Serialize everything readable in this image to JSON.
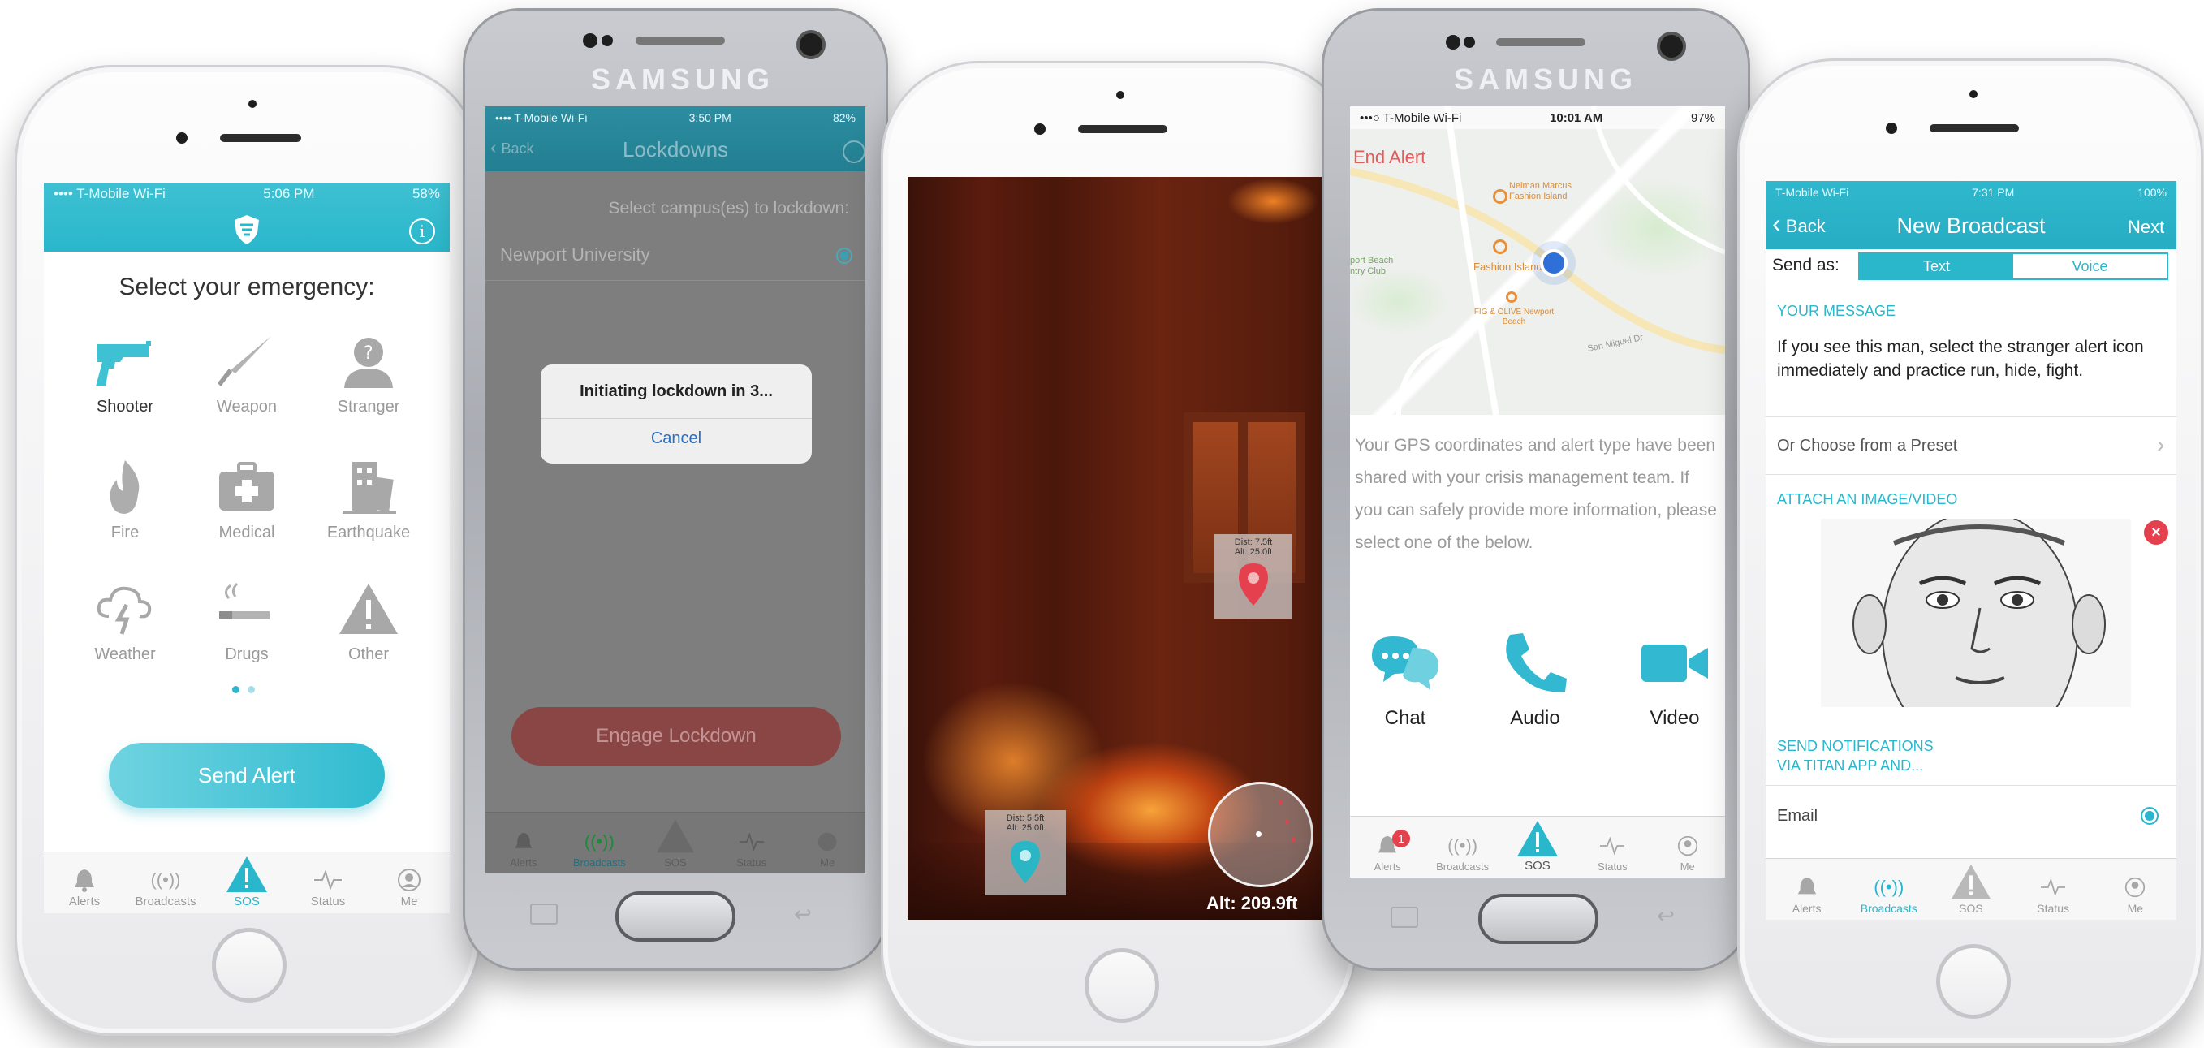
{
  "phone1": {
    "status": {
      "carrier": "•••• T-Mobile Wi-Fi",
      "time": "5:06 PM",
      "battery": "58%"
    },
    "heading": "Select your emergency:",
    "emergencies": [
      {
        "label": "Shooter",
        "icon": "gun-icon"
      },
      {
        "label": "Weapon",
        "icon": "knife-icon"
      },
      {
        "label": "Stranger",
        "icon": "stranger-icon"
      },
      {
        "label": "Fire",
        "icon": "fire-icon"
      },
      {
        "label": "Medical",
        "icon": "medical-kit-icon"
      },
      {
        "label": "Earthquake",
        "icon": "earthquake-icon"
      },
      {
        "label": "Weather",
        "icon": "storm-cloud-icon"
      },
      {
        "label": "Drugs",
        "icon": "drugs-icon"
      },
      {
        "label": "Other",
        "icon": "warning-icon"
      }
    ],
    "send_button": "Send Alert",
    "tabs": [
      "Alerts",
      "Broadcasts",
      "SOS",
      "Status",
      "Me"
    ],
    "accent": "#2ab7cc"
  },
  "phone2": {
    "brand": "SAMSUNG",
    "status": {
      "carrier": "•••• T-Mobile Wi-Fi",
      "time": "3:50 PM",
      "battery": "82%"
    },
    "nav_back": "Back",
    "nav_title": "Lockdowns",
    "prompt": "Select campus(es) to lockdown:",
    "campus": "Newport University",
    "dialog_title": "Initiating lockdown in 3...",
    "dialog_cancel": "Cancel",
    "engage_button": "Engage Lockdown",
    "tabs": [
      "Alerts",
      "Broadcasts",
      "SOS",
      "Status",
      "Me"
    ]
  },
  "phone3": {
    "pin_red": {
      "dist": "Dist: 7.5ft",
      "alt": "Alt: 25.0ft"
    },
    "pin_teal": {
      "dist": "Dist: 5.5ft",
      "alt": "Alt: 25.0ft"
    },
    "altitude": "Alt: 209.9ft"
  },
  "phone4": {
    "brand": "SAMSUNG",
    "status": {
      "carrier": "•••○ T-Mobile Wi-Fi",
      "time": "10:01 AM",
      "battery": "97%"
    },
    "end_alert": "End Alert",
    "map_labels": [
      "Neiman Marcus Fashion Island",
      "Fashion Island",
      "FIG & OLIVE Newport Beach",
      "port Beach ntry Club",
      "San Miguel Dr"
    ],
    "message": "Your GPS coordinates and alert type have been shared with your crisis management team. If you can safely provide more information, please select one of the below.",
    "options": [
      "Chat",
      "Audio",
      "Video"
    ],
    "badge": "1",
    "tabs": [
      "Alerts",
      "Broadcasts",
      "SOS",
      "Status",
      "Me"
    ]
  },
  "phone5": {
    "status": {
      "carrier": "T-Mobile Wi-Fi",
      "time": "7:31 PM",
      "battery": "100%"
    },
    "nav_back": "Back",
    "nav_title": "New Broadcast",
    "nav_next": "Next",
    "send_as": "Send as:",
    "seg_text": "Text",
    "seg_voice": "Voice",
    "your_message_header": "YOUR MESSAGE",
    "message": "If you see this man, select the stranger alert icon immediately and practice run, hide, fight.",
    "preset": "Or Choose from a Preset",
    "attach_header": "ATTACH AN IMAGE/VIDEO",
    "notify_header_1": "SEND NOTIFICATIONS",
    "notify_header_2": "VIA TITAN APP AND...",
    "email_label": "Email",
    "tabs": [
      "Alerts",
      "Broadcasts",
      "SOS",
      "Status",
      "Me"
    ]
  }
}
